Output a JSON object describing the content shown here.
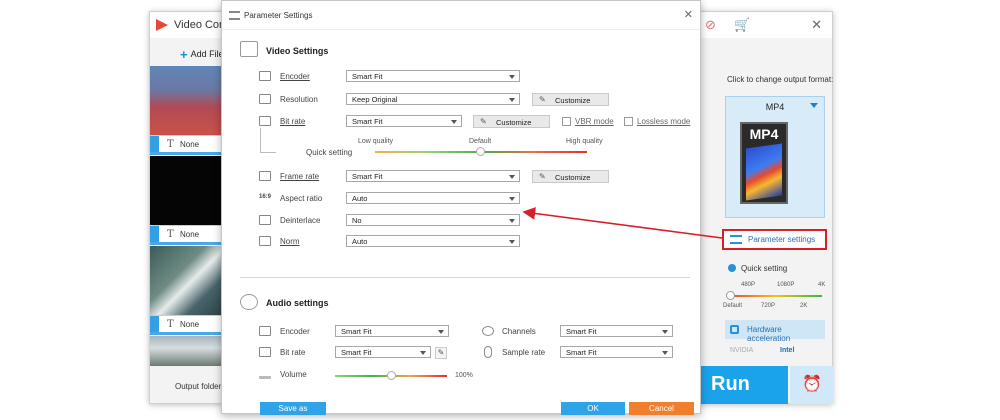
{
  "main_window": {
    "title": "Video Conv",
    "add_files": "Add File",
    "thumb_labels": [
      "None",
      "None",
      "None"
    ],
    "output_folder": "Output folder:",
    "colors": {
      "accent": "#1aa3ea",
      "logo": "#e8463a"
    }
  },
  "right_panel": {
    "change_format_label": "Click to change output format:",
    "format": "MP4",
    "format_icon_text": "MP4",
    "parameter_settings": "Parameter settings",
    "quick_setting": "Quick setting",
    "ticks_top": [
      "480P",
      "1080P",
      "4K"
    ],
    "ticks_bottom": [
      "Default",
      "720P",
      "2K"
    ],
    "hardware_acceleration": "Hardware acceleration",
    "brands": [
      "NVIDIA",
      "Intel"
    ],
    "run": "Run"
  },
  "dialog": {
    "title": "Parameter Settings",
    "video_section": "Video Settings",
    "video": {
      "encoder_label": "Encoder",
      "encoder_value": "Smart Fit",
      "resolution_label": "Resolution",
      "resolution_value": "Keep Original",
      "bitrate_label": "Bit rate",
      "bitrate_value": "Smart Fit",
      "customize": "Customize",
      "vbr_mode": "VBR mode",
      "lossless_mode": "Lossless mode",
      "quick_setting": "Quick setting",
      "low_quality": "Low quality",
      "default": "Default",
      "high_quality": "High quality",
      "framerate_label": "Frame rate",
      "framerate_value": "Smart Fit",
      "aspect_label": "Aspect ratio",
      "aspect_value": "Auto",
      "aspect_icon_text": "16:9",
      "deinterlace_label": "Deinterlace",
      "deinterlace_value": "No",
      "norm_label": "Norm",
      "norm_value": "Auto"
    },
    "audio_section": "Audio settings",
    "audio": {
      "encoder_label": "Encoder",
      "encoder_value": "Smart Fit",
      "channels_label": "Channels",
      "channels_value": "Smart Fit",
      "bitrate_label": "Bit rate",
      "bitrate_value": "Smart Fit",
      "samplerate_label": "Sample rate",
      "samplerate_value": "Smart Fit",
      "volume_label": "Volume",
      "volume_value": "100%"
    },
    "save_as": "Save as",
    "ok": "OK",
    "cancel": "Cancel",
    "colors": {
      "save_as": "#2fa3e8",
      "ok": "#2fa3e8",
      "cancel": "#f07f2d",
      "highlight": "#d91f26"
    }
  }
}
